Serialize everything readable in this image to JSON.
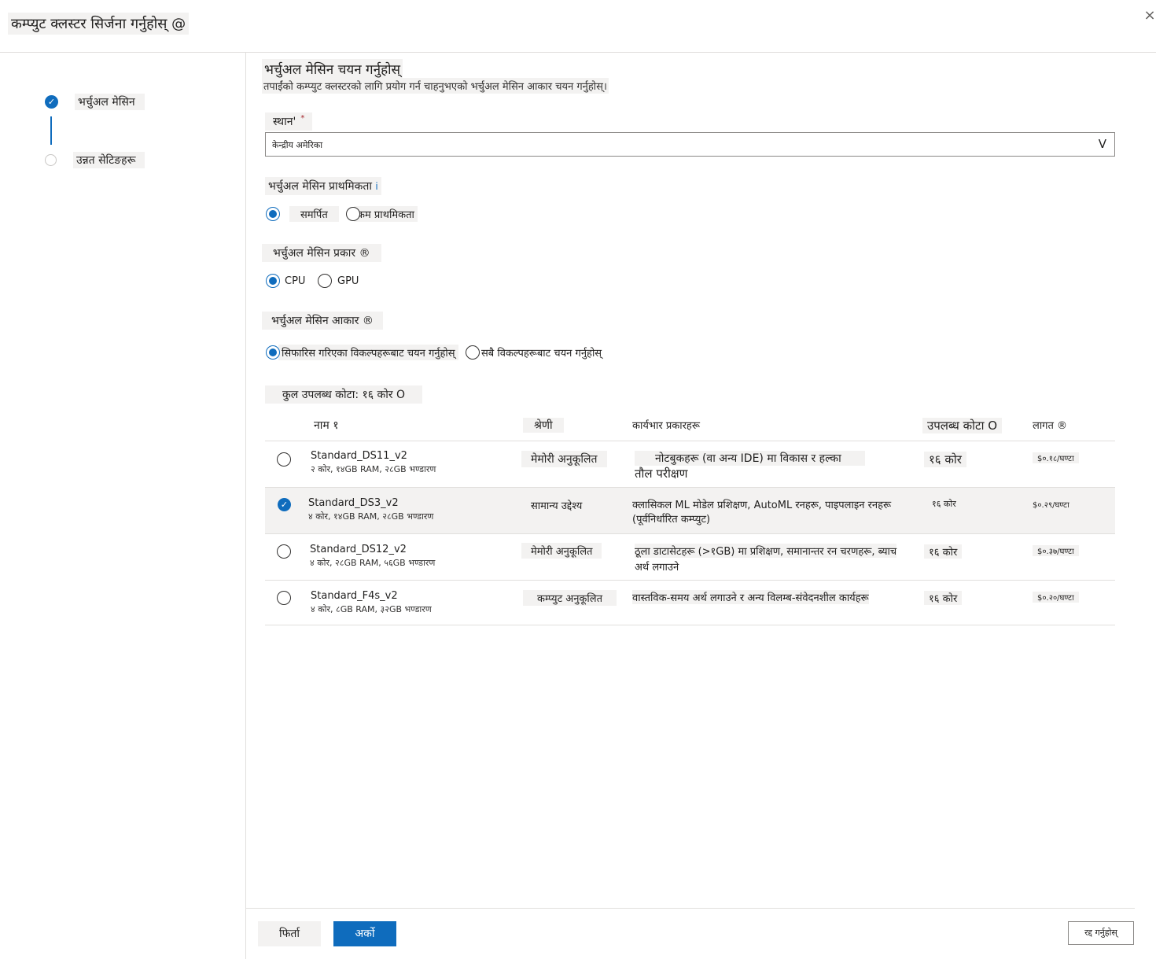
{
  "dialog": {
    "title": "कम्प्युट क्लस्टर सिर्जना गर्नुहोस् @",
    "close_icon": "×"
  },
  "steps": [
    {
      "label": "भर्चुअल मेसिन",
      "state": "completed"
    },
    {
      "label": "उन्नत सेटिङहरू",
      "state": "pending"
    }
  ],
  "section": {
    "title": "भर्चुअल मेसिन चयन गर्नुहोस्",
    "subtitle": "तपाईंको कम्प्युट क्लस्टरको लागि प्रयोग गर्न चाहनुभएको भर्चुअल मेसिन आकार चयन गर्नुहोस्।"
  },
  "location": {
    "label": "स्थान'",
    "required_mark": "*",
    "value": "केन्द्रीय अमेरिका",
    "caret": "V"
  },
  "priority": {
    "label": "भर्चुअल मेसिन प्राथमिकता",
    "info_icon": "i",
    "options": [
      {
        "label": "समर्पित",
        "selected": true
      },
      {
        "label": "कम प्राथमिकता",
        "selected": false
      }
    ]
  },
  "vm_type": {
    "label": "भर्चुअल मेसिन प्रकार ®",
    "options": [
      {
        "label": "CPU",
        "selected": true
      },
      {
        "label": "GPU",
        "selected": false
      }
    ]
  },
  "vm_size": {
    "label": "भर्चुअल मेसिन आकार ®",
    "options": [
      {
        "label": "सिफारिस गरिएका विकल्पहरूबाट चयन गर्नुहोस्",
        "selected": true
      },
      {
        "label": "सबै विकल्पहरूबाट चयन गर्नुहोस्",
        "selected": false
      }
    ]
  },
  "quota": {
    "text": "कुल उपलब्ध कोटा: १६ कोर O"
  },
  "table": {
    "headers": {
      "name": "नाम १",
      "category": "श्रेणी",
      "workload": "कार्यभार प्रकारहरू",
      "quota": "उपलब्ध कोटा O",
      "cost": "लागत ®"
    },
    "rows": [
      {
        "name": "Standard_DS11_v2",
        "spec": "२ कोर, १४GB RAM, २८GB भण्डारण",
        "category": "मेमोरी अनुकूलित",
        "workload_line1": "नोटबुकहरू (वा अन्य IDE) मा विकास र हल्का",
        "workload_line2": "तौल परीक्षण",
        "quota": "१६ कोर",
        "cost": "$०.१८/घण्टा",
        "selected": false
      },
      {
        "name": "Standard_DS3_v2",
        "spec": "४ कोर, १४GB RAM, २८GB भण्डारण",
        "category": "सामान्य उद्देश्य",
        "workload_line1": "क्लासिकल ML मोडेल प्रशिक्षण, AutoML रनहरू, पाइपलाइन रनहरू",
        "workload_line2": "(पूर्वनिर्धारित कम्प्युट)",
        "quota": "१६ कोर",
        "cost": "$०.२९/घण्टा",
        "selected": true
      },
      {
        "name": "Standard_DS12_v2",
        "spec": "४ कोर, २८GB RAM, ५६GB भण्डारण",
        "category": "मेमोरी अनुकूलित",
        "workload_line1": "ठूला डाटासेटहरू (>१GB) मा प्रशिक्षण, समानान्तर रन चरणहरू, ब्याच",
        "workload_line2": "अर्थ लगाउने",
        "quota": "१६ कोर",
        "cost": "$०.३७/घण्टा",
        "selected": false
      },
      {
        "name": "Standard_F4s_v2",
        "spec": "४ कोर, ८GB RAM, ३२GB भण्डारण",
        "category": "कम्प्युट अनुकूलित",
        "workload_line1": "वास्तविक-समय अर्थ लगाउने र अन्य विलम्ब-संवेदनशील कार्यहरू",
        "workload_line2": "",
        "quota": "१६ कोर",
        "cost": "$०.२०/घण्टा",
        "selected": false
      }
    ]
  },
  "footer": {
    "back_label": "फिर्ता",
    "next_label": "अर्को",
    "cancel_label": "रद्द गर्नुहोस्"
  },
  "colors": {
    "accent": "#0f6cbd",
    "label_bg": "#f3f2f1"
  }
}
